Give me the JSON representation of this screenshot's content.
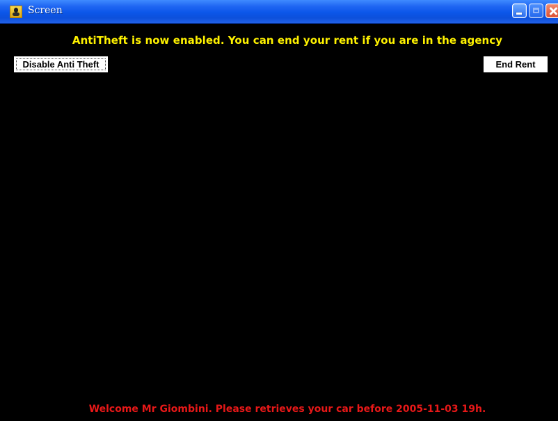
{
  "window": {
    "title": "Screen",
    "icon": "java-app-icon",
    "controls": {
      "minimize": "minimize-icon",
      "maximize": "maximize-icon",
      "close": "close-icon"
    }
  },
  "content": {
    "status_message": "AntiTheft is now enabled. You can end your rent if you are in the agency",
    "buttons": {
      "disable_anti_theft": "Disable Anti Theft",
      "end_rent": "End Rent"
    },
    "welcome_message": "Welcome Mr Giombini. Please retrieves your car before 2005-11-03 19h."
  },
  "colors": {
    "background": "#000000",
    "status_text": "#fff200",
    "welcome_text": "#e81818",
    "title_bar": "#0b56e9",
    "button_background": "#ffffff"
  }
}
